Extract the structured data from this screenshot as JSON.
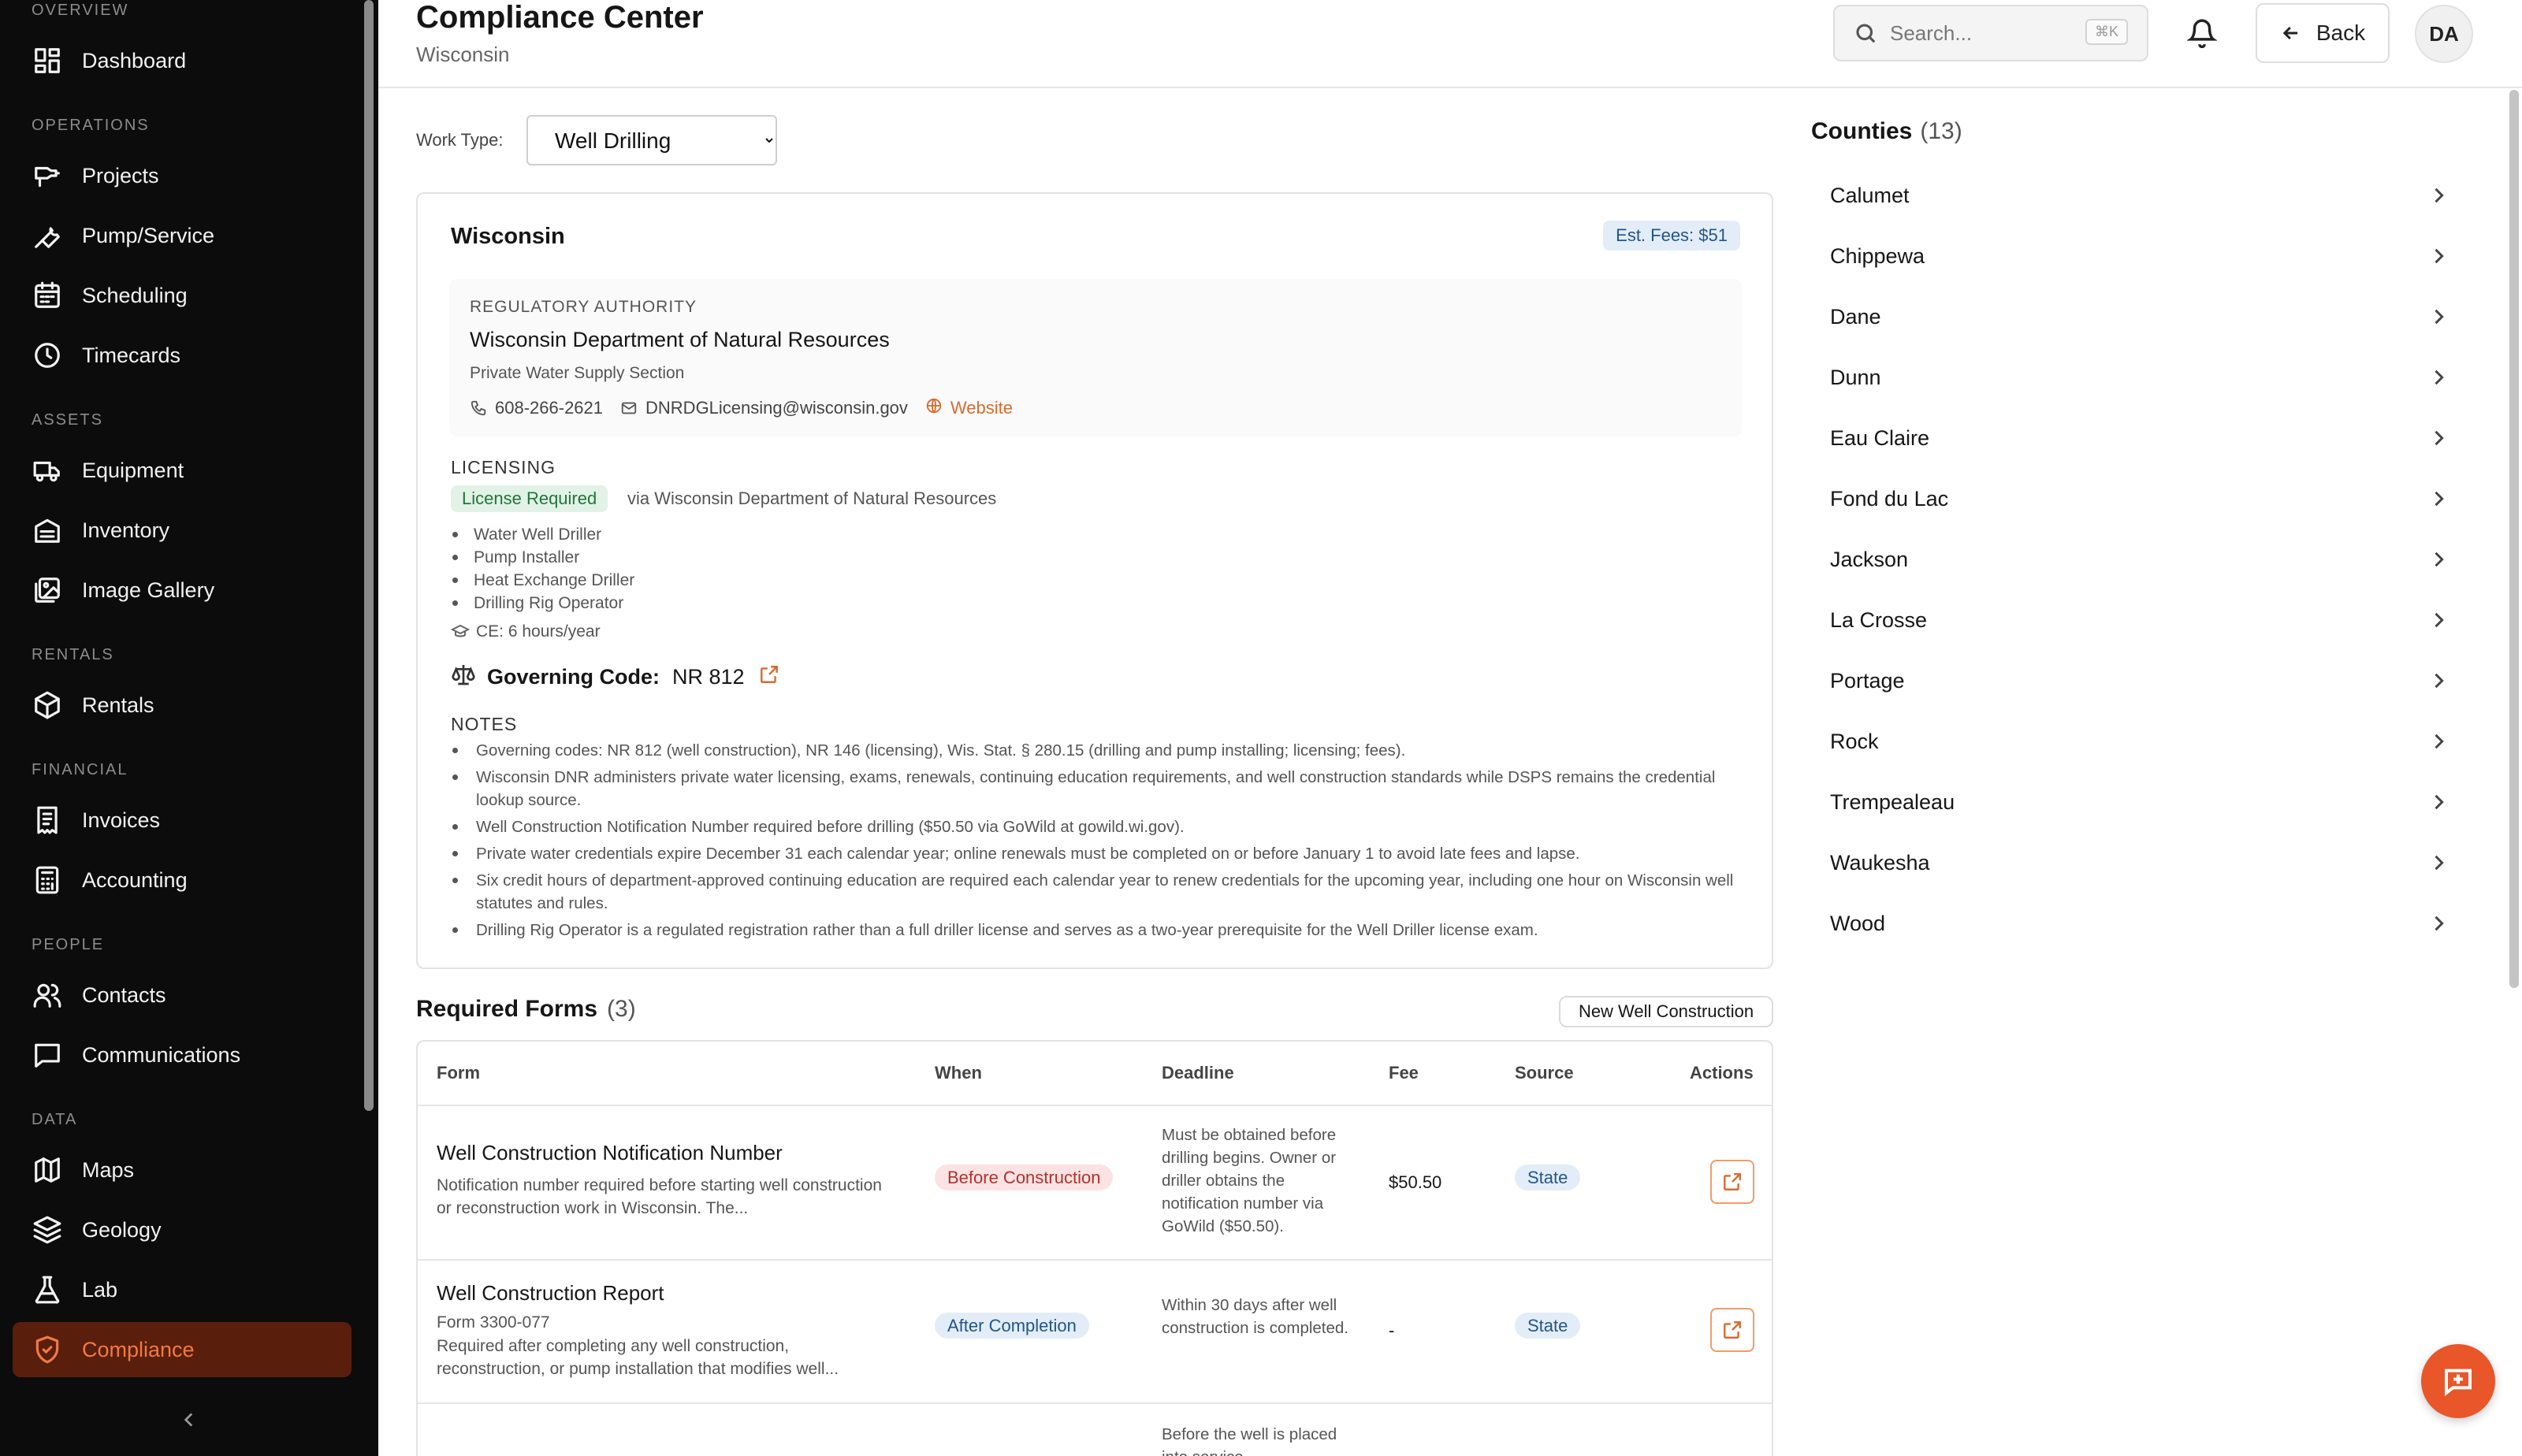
{
  "sidebar": {
    "sections": [
      "OVERVIEW",
      "OPERATIONS",
      "ASSETS",
      "RENTALS",
      "FINANCIAL",
      "PEOPLE",
      "DATA"
    ],
    "items": [
      {
        "label": "Dashboard",
        "icon": "dashboard-icon"
      },
      {
        "label": "Projects",
        "icon": "drill-icon"
      },
      {
        "label": "Pump/Service",
        "icon": "wrench-icon"
      },
      {
        "label": "Scheduling",
        "icon": "calendar-icon"
      },
      {
        "label": "Timecards",
        "icon": "clock-icon"
      },
      {
        "label": "Equipment",
        "icon": "truck-icon"
      },
      {
        "label": "Inventory",
        "icon": "warehouse-icon"
      },
      {
        "label": "Image Gallery",
        "icon": "image-icon"
      },
      {
        "label": "Rentals",
        "icon": "package-icon"
      },
      {
        "label": "Invoices",
        "icon": "receipt-icon"
      },
      {
        "label": "Accounting",
        "icon": "calculator-icon"
      },
      {
        "label": "Contacts",
        "icon": "users-icon"
      },
      {
        "label": "Communications",
        "icon": "message-square-icon"
      },
      {
        "label": "Maps",
        "icon": "map-icon"
      },
      {
        "label": "Geology",
        "icon": "layers-icon"
      },
      {
        "label": "Lab",
        "icon": "flask-icon"
      },
      {
        "label": "Compliance",
        "icon": "shield-icon"
      }
    ],
    "active": "Compliance"
  },
  "header": {
    "title": "Compliance Center",
    "subtitle": "Wisconsin",
    "search_placeholder": "Search...",
    "search_shortcut": "⌘K",
    "back_label": "Back",
    "avatar_initials": "DA"
  },
  "work_type": {
    "label": "Work Type:",
    "selected": "Well Drilling"
  },
  "state_card": {
    "name": "Wisconsin",
    "fees_badge": "Est. Fees: $51",
    "authority": {
      "label": "REGULATORY AUTHORITY",
      "name": "Wisconsin Department of Natural Resources",
      "section": "Private Water Supply Section",
      "phone": "608-266-2621",
      "email": "DNRDGLicensing@wisconsin.gov",
      "website_label": "Website"
    },
    "licensing": {
      "label": "LICENSING",
      "badge": "License Required",
      "via": "via Wisconsin Department of Natural Resources",
      "licenses": [
        "Water Well Driller",
        "Pump Installer",
        "Heat Exchange Driller",
        "Drilling Rig Operator"
      ],
      "ce": "CE: 6 hours/year"
    },
    "governing_code": {
      "label": "Governing Code:",
      "value": "NR 812"
    },
    "notes": {
      "label": "NOTES",
      "items": [
        "Governing codes: NR 812 (well construction), NR 146 (licensing), Wis. Stat. § 280.15 (drilling and pump installing; licensing; fees).",
        "Wisconsin DNR administers private water licensing, exams, renewals, continuing education requirements, and well construction standards while DSPS remains the credential lookup source.",
        "Well Construction Notification Number required before drilling ($50.50 via GoWild at gowild.wi.gov).",
        "Private water credentials expire December 31 each calendar year; online renewals must be completed on or before January 1 to avoid late fees and lapse.",
        "Six credit hours of department-approved continuing education are required each calendar year to renew credentials for the upcoming year, including one hour on Wisconsin well statutes and rules.",
        "Drilling Rig Operator is a regulated registration rather than a full driller license and serves as a two-year prerequisite for the Well Driller license exam."
      ]
    }
  },
  "required_forms": {
    "title": "Required Forms",
    "count": "(3)",
    "badge": "New Well Construction",
    "columns": [
      "Form",
      "When",
      "Deadline",
      "Fee",
      "Source",
      "Actions"
    ],
    "rows": [
      {
        "name": "Well Construction Notification Number",
        "form_no": "",
        "description": "Notification number required before starting well construction or reconstruction work in Wisconsin. The...",
        "when": "Before Construction",
        "deadline": "Must be obtained before drilling begins. Owner or driller obtains the notification number via GoWild ($50.50).",
        "fee": "$50.50",
        "source": "State"
      },
      {
        "name": "Well Construction Report",
        "form_no": "Form 3300-077",
        "description": "Required after completing any well construction, reconstruction, or pump installation that modifies well...",
        "when": "After Completion",
        "deadline": "Within 30 days after well construction is completed.",
        "fee": "-",
        "source": "State"
      },
      {
        "name": "",
        "form_no": "",
        "description": "",
        "when": "",
        "deadline": "Before the well is placed into service",
        "fee": "",
        "source": ""
      }
    ]
  },
  "counties": {
    "title": "Counties",
    "count": "(13)",
    "items": [
      "Calumet",
      "Chippewa",
      "Dane",
      "Dunn",
      "Eau Claire",
      "Fond du Lac",
      "Jackson",
      "La Crosse",
      "Portage",
      "Rock",
      "Trempealeau",
      "Waukesha",
      "Wood"
    ]
  },
  "colors": {
    "sidebar_bg": "#0c0c0c",
    "accent": "#e8562a",
    "active_nav_bg": "#5a1e0c"
  }
}
